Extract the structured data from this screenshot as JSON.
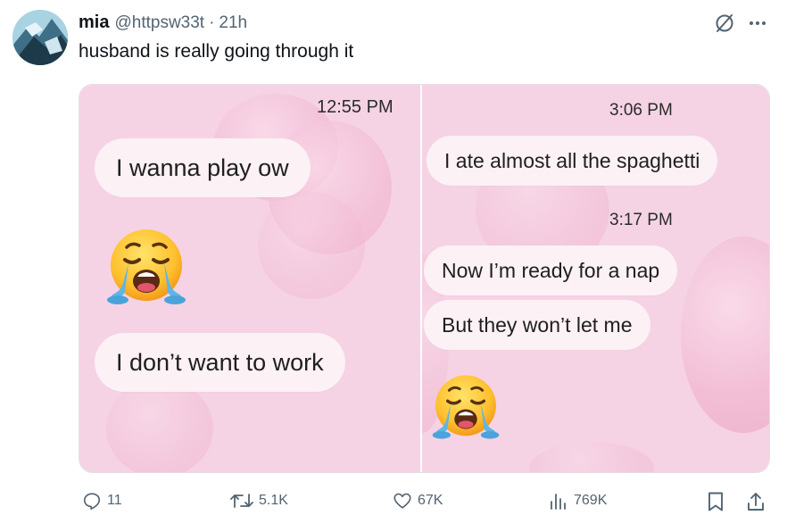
{
  "tweet": {
    "author_name": "mia",
    "handle": "@httpsw33t",
    "separator": "·",
    "time_ago": "21h",
    "text": "husband is really going through it"
  },
  "media": {
    "left_panel": {
      "timestamp": "12:55 PM",
      "messages": [
        "I wanna play ow",
        "I don’t want to work"
      ],
      "emoji": "loudly-crying-face"
    },
    "right_panel": {
      "timestamp_1": "3:06 PM",
      "messages_1": [
        "I ate almost all the spaghetti"
      ],
      "timestamp_2": "3:17 PM",
      "messages_2": [
        "Now I’m ready for a nap",
        "But they won’t let me"
      ],
      "emoji": "loudly-crying-face"
    },
    "colors": {
      "background": "#f5d3e4",
      "bubble": "#fcf1f5"
    }
  },
  "actions": {
    "replies": "11",
    "reposts": "5.1K",
    "likes": "67K",
    "views": "769K"
  },
  "icons": [
    "grok-icon",
    "more-icon",
    "reply-icon",
    "repost-icon",
    "like-icon",
    "views-icon",
    "bookmark-icon",
    "share-icon"
  ]
}
